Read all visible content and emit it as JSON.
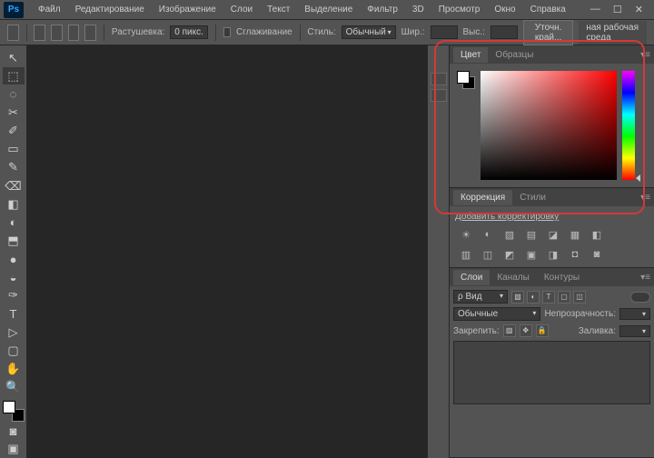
{
  "app": {
    "logo": "Ps"
  },
  "menu": [
    "Файл",
    "Редактирование",
    "Изображение",
    "Слои",
    "Текст",
    "Выделение",
    "Фильтр",
    "3D",
    "Просмотр",
    "Окно",
    "Справка"
  ],
  "win_controls": {
    "min": "—",
    "max": "☐",
    "close": "✕"
  },
  "options": {
    "feather_label": "Растушевка:",
    "feather_value": "0 пикс.",
    "antialias_label": "Сглаживание",
    "style_label": "Стиль:",
    "style_value": "Обычный",
    "width_label": "Шир.:",
    "height_label": "Выс.:",
    "refine_btn": "Уточн. край...",
    "workspace": "ная рабочая среда"
  },
  "tools": [
    "↖",
    "⬚",
    "◌",
    "✂",
    "✐",
    "▭",
    "✎",
    "⌫",
    "◧",
    "◐",
    "⬒",
    "●",
    "◒",
    "✑",
    "T",
    "▷",
    "▢",
    "✋",
    "🔍"
  ],
  "panels": {
    "color": {
      "tab1": "Цвет",
      "tab2": "Образцы"
    },
    "adjust": {
      "tab1": "Коррекция",
      "tab2": "Стили",
      "link": "Добавить корректировку"
    },
    "adjust_icons": [
      "☀",
      "◐",
      "▨",
      "▤",
      "◪",
      "▦",
      "◧",
      "▥",
      "◫",
      "◩",
      "▣",
      "◨",
      "◘",
      "◙"
    ],
    "layers": {
      "tab1": "Слои",
      "tab2": "Каналы",
      "tab3": "Контуры",
      "kind_label": "ρ Вид",
      "blend": "Обычные",
      "opacity_label": "Непрозрачность:",
      "lock_label": "Закрепить:",
      "fill_label": "Заливка:"
    }
  }
}
